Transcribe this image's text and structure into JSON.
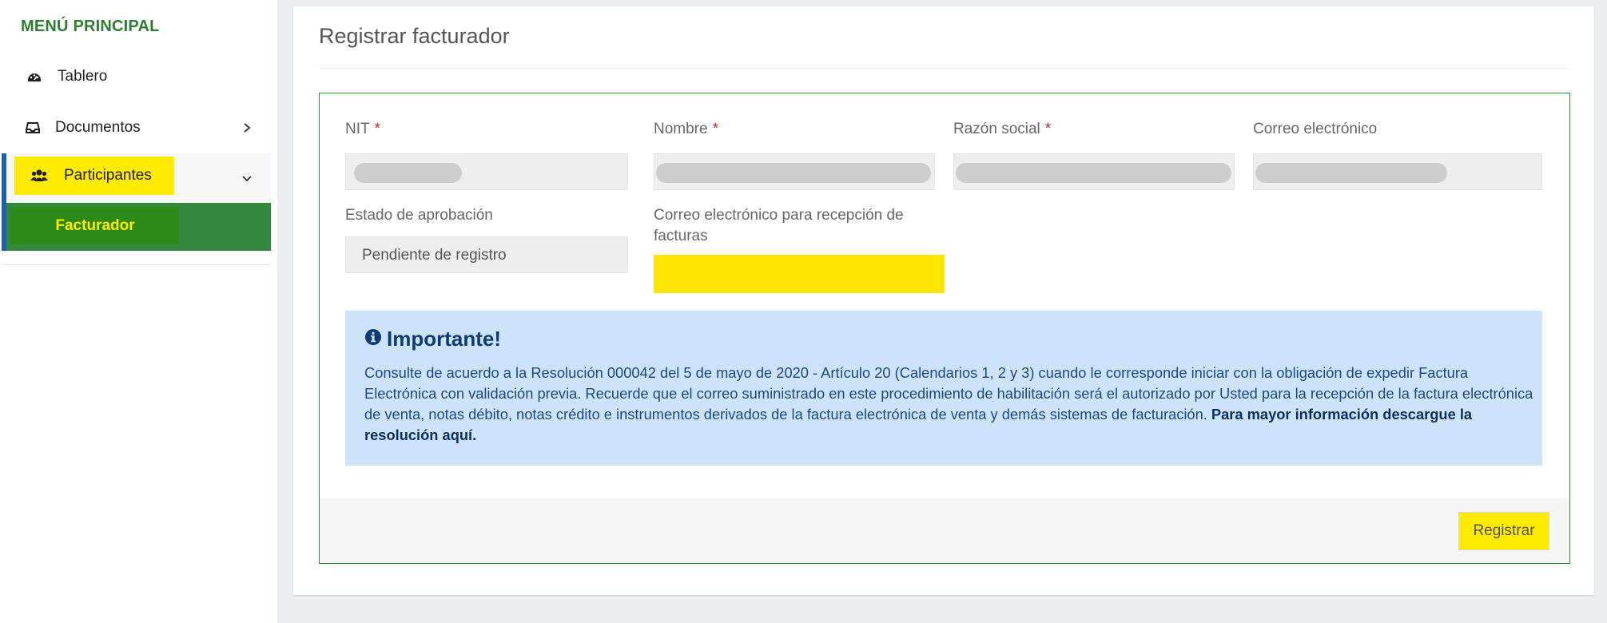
{
  "sidebar": {
    "menu_title": "MENÚ PRINCIPAL",
    "items": [
      {
        "label": "Tablero",
        "icon": "dashboard-icon"
      },
      {
        "label": "Documentos",
        "icon": "inbox-icon"
      },
      {
        "label": "Participantes",
        "icon": "users-icon"
      }
    ],
    "subitem_active": "Facturador",
    "accent_color": "#33873f",
    "highlight_color": "#ffea00"
  },
  "page": {
    "title": "Registrar facturador"
  },
  "form": {
    "fields": {
      "nit": {
        "label": "NIT",
        "required_mark": "*"
      },
      "nombre": {
        "label": "Nombre",
        "required_mark": "*"
      },
      "razon_social": {
        "label": "Razón social",
        "required_mark": "*"
      },
      "correo": {
        "label": "Correo electrónico"
      },
      "estado": {
        "label": "Estado de aprobación",
        "value": "Pendiente de registro"
      },
      "correo_recepcion": {
        "label": "Correo electrónico para recepción de facturas"
      }
    },
    "alert": {
      "title": "Importante!",
      "body": "Consulte de acuerdo a la Resolución 000042 del 5 de mayo de 2020 - Artículo 20 (Calendarios 1, 2 y 3) cuando le corresponde iniciar con la obligación de expedir Factura Electrónica con validación previa. Recuerde que el correo suministrado en este procedimiento de habilitación será el autorizado por Usted para la recepción de la factura electrónica de venta, notas débito, notas crédito e instrumentos derivados de la factura electrónica de venta y demás sistemas de facturación.",
      "link_text": "Para mayor información descargue la resolución aquí.",
      "background": "#cce3fb"
    },
    "submit_label": "Registrar",
    "border_color": "#2e8b3e"
  }
}
